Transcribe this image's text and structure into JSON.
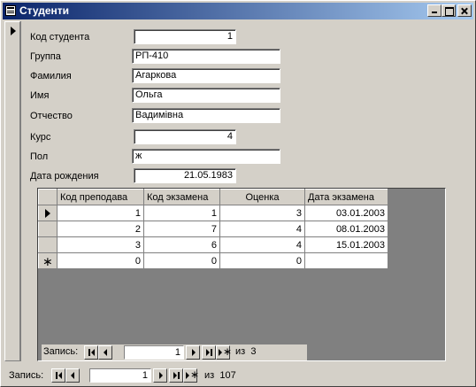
{
  "window": {
    "title": "Студенти"
  },
  "form": {
    "fields": [
      {
        "label": "Код студента",
        "value": "1"
      },
      {
        "label": "Группа",
        "value": "РП-410"
      },
      {
        "label": "Фамилия",
        "value": "Агаркова"
      },
      {
        "label": "Имя",
        "value": "Ольга"
      },
      {
        "label": "Отчество",
        "value": "Вадимівна"
      },
      {
        "label": "Курс",
        "value": "4"
      },
      {
        "label": "Пол",
        "value": "ж"
      },
      {
        "label": "Дата рождения",
        "value": "21.05.1983"
      }
    ]
  },
  "subform": {
    "columns": [
      "Код преподава",
      "Код экзамена",
      "Оценка",
      "Дата экзамена"
    ],
    "rows": [
      [
        "1",
        "1",
        "3",
        "03.01.2003"
      ],
      [
        "2",
        "7",
        "4",
        "08.01.2003"
      ],
      [
        "3",
        "6",
        "4",
        "15.01.2003"
      ]
    ],
    "new_row": [
      "0",
      "0",
      "0",
      ""
    ],
    "nav": {
      "label": "Запись:",
      "current": "1",
      "of_label": "из",
      "total": "3"
    }
  },
  "main_nav": {
    "label": "Запись:",
    "current": "1",
    "of_label": "из",
    "total": "107"
  },
  "icons": {
    "first": "first-record-icon",
    "prev": "prev-record-icon",
    "next": "next-record-icon",
    "last": "last-record-icon",
    "new": "new-record-icon",
    "current": "current-record-icon"
  }
}
